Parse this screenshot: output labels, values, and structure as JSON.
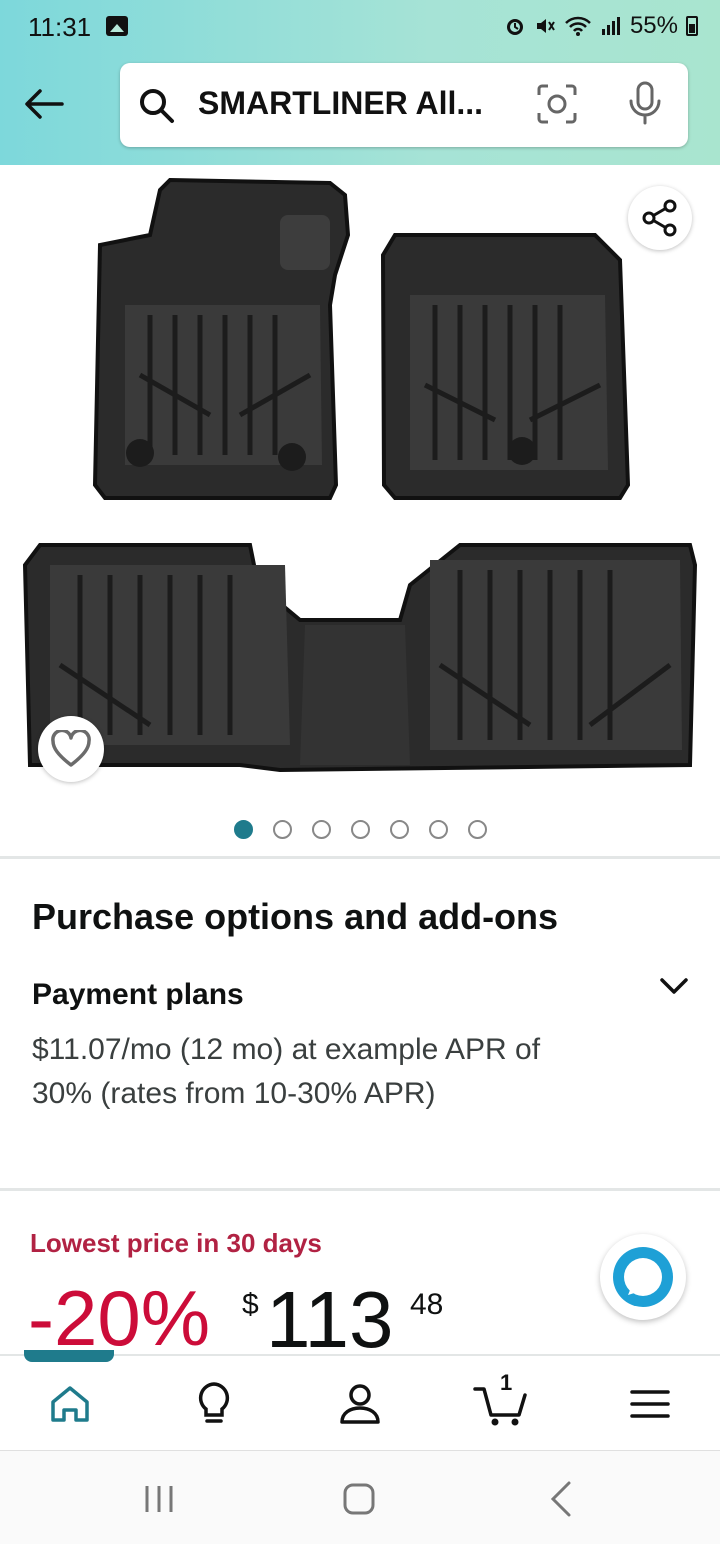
{
  "status_bar": {
    "time": "11:31",
    "battery": "55%"
  },
  "search": {
    "query": "SMARTLINER All..."
  },
  "carousel": {
    "image_count": 7,
    "active_index": 0
  },
  "purchase": {
    "title": "Purchase options and add-ons",
    "payment_label": "Payment plans",
    "payment_desc": "$11.07/mo (12 mo) at example APR of 30% (rates from 10-30% APR)"
  },
  "pricing": {
    "deal_label": "Lowest price in 30 days",
    "discount": "-20%",
    "currency": "$",
    "whole": "113",
    "fraction": "48"
  },
  "nav": {
    "cart_count": "1",
    "active": "home"
  },
  "colors": {
    "accent": "#1f7b8c",
    "deal": "#b12243",
    "discount": "#cc0c39",
    "header_gradient_start": "#7dd8db"
  }
}
